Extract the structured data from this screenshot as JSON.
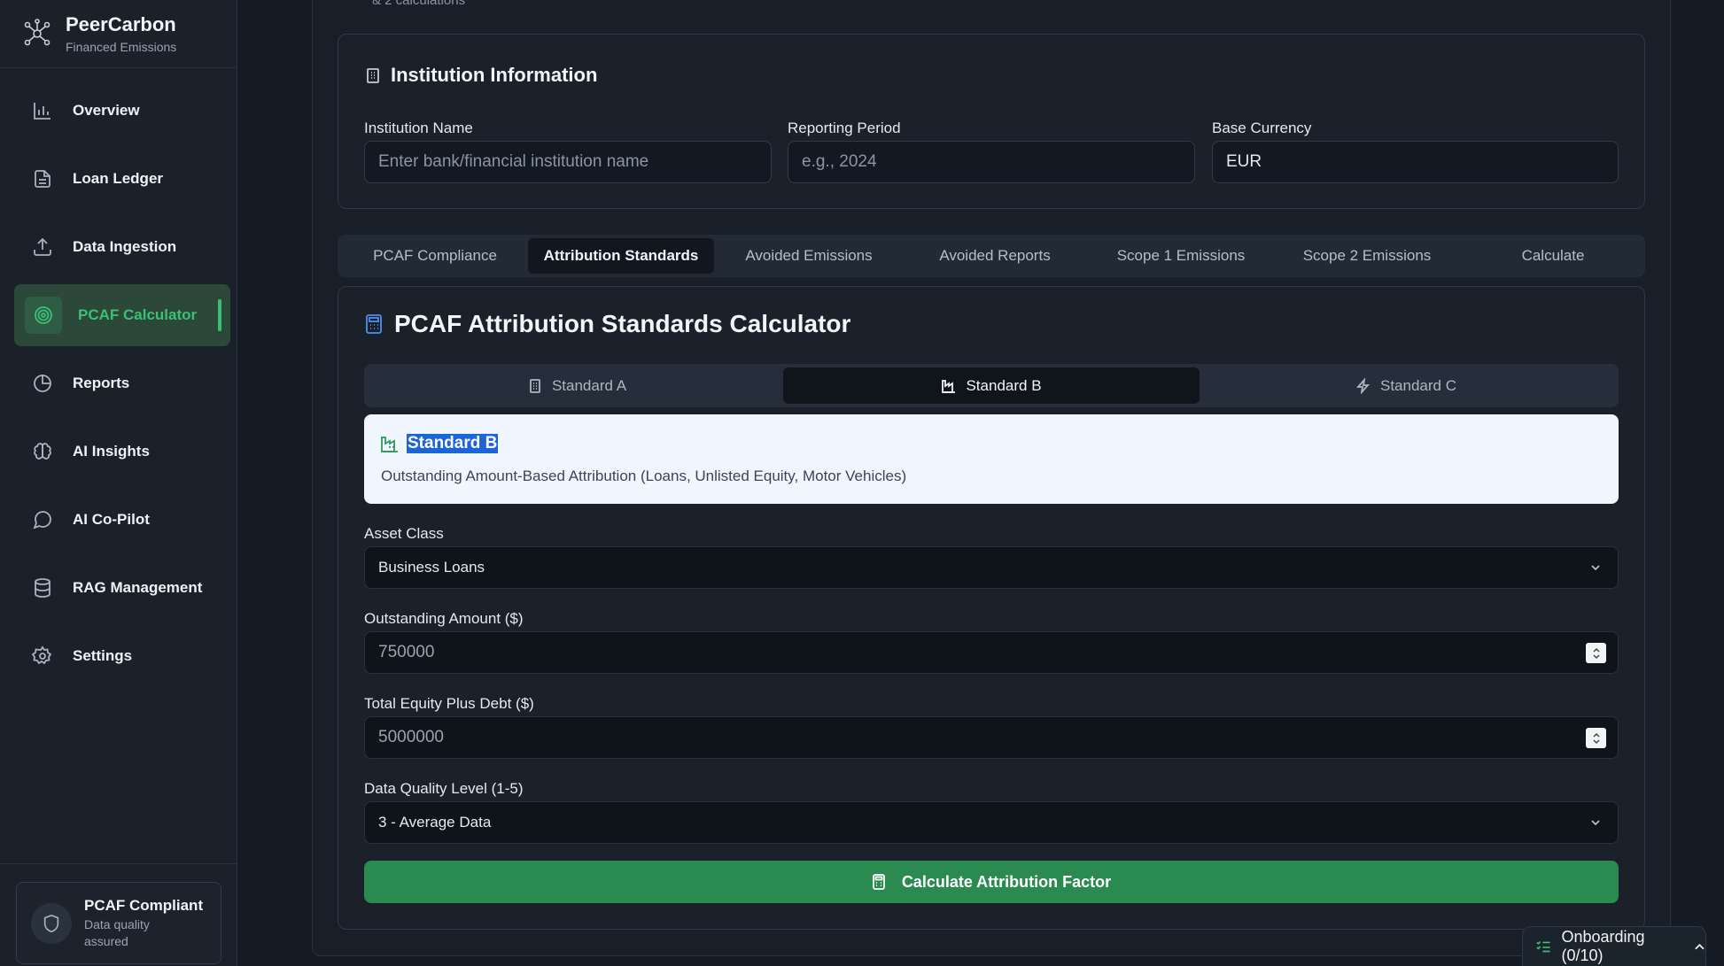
{
  "brand": {
    "title": "PeerCarbon",
    "subtitle": "Financed Emissions"
  },
  "sidebar": {
    "items": [
      {
        "label": "Overview",
        "icon": "bar-chart-icon"
      },
      {
        "label": "Loan Ledger",
        "icon": "document-icon"
      },
      {
        "label": "Data Ingestion",
        "icon": "upload-icon"
      },
      {
        "label": "PCAF Calculator",
        "icon": "target-icon",
        "active": true
      },
      {
        "label": "Reports",
        "icon": "pie-chart-icon"
      },
      {
        "label": "AI Insights",
        "icon": "brain-icon"
      },
      {
        "label": "AI Co-Pilot",
        "icon": "chat-bubble-icon"
      },
      {
        "label": "RAG Management",
        "icon": "database-icon"
      },
      {
        "label": "Settings",
        "icon": "gear-icon"
      }
    ],
    "footer": {
      "title": "PCAF Compliant",
      "subtitle": "Data quality assured"
    }
  },
  "top_clip": "& 2 calculations",
  "institution": {
    "title": "Institution Information",
    "name_label": "Institution Name",
    "name_placeholder": "Enter bank/financial institution name",
    "period_label": "Reporting Period",
    "period_placeholder": "e.g., 2024",
    "currency_label": "Base Currency",
    "currency_value": "EUR"
  },
  "tabs": [
    {
      "label": "PCAF Compliance"
    },
    {
      "label": "Attribution Standards",
      "active": true
    },
    {
      "label": "Avoided Emissions"
    },
    {
      "label": "Avoided Reports"
    },
    {
      "label": "Scope 1 Emissions"
    },
    {
      "label": "Scope 2 Emissions"
    },
    {
      "label": "Calculate"
    }
  ],
  "calculator": {
    "title": "PCAF Attribution Standards Calculator",
    "standards": [
      {
        "label": "Standard A",
        "icon": "building-icon"
      },
      {
        "label": "Standard B",
        "icon": "factory-icon",
        "active": true
      },
      {
        "label": "Standard C",
        "icon": "lightning-icon"
      }
    ],
    "selected_title": "Standard B",
    "selected_description": "Outstanding Amount-Based Attribution (Loans, Unlisted Equity, Motor Vehicles)",
    "asset_class_label": "Asset Class",
    "asset_class_value": "Business Loans",
    "outstanding_label": "Outstanding Amount ($)",
    "outstanding_placeholder": "750000",
    "total_label": "Total Equity Plus Debt ($)",
    "total_placeholder": "5000000",
    "quality_label": "Data Quality Level (1-5)",
    "quality_value": "3 - Average Data",
    "button_label": "Calculate Attribution Factor"
  },
  "onboarding": {
    "label": "Onboarding (0/10)"
  },
  "colors": {
    "accent": "#3cbf76",
    "button": "#2a8a4f",
    "highlight": "#1d64d6"
  }
}
